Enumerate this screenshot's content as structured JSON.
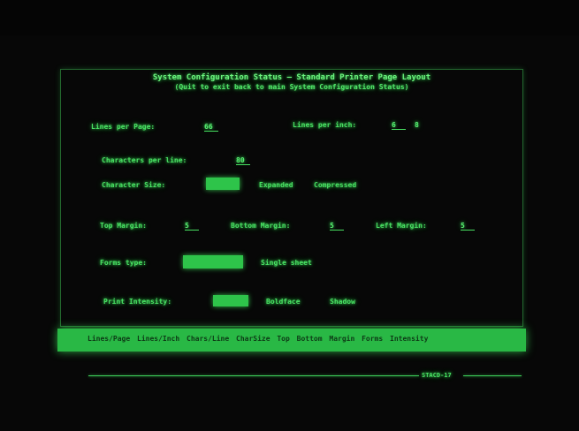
{
  "header": {
    "title": "System Configuration Status — Standard Printer Page Layout",
    "subtitle": "(Quit to exit back to main System Configuration Status)"
  },
  "fields": {
    "lines_per_page": {
      "label": "Lines per Page:",
      "value": "66"
    },
    "lines_per_inch": {
      "label": "Lines per inch:",
      "value": "6",
      "alt": "8"
    },
    "chars_per_line": {
      "label": "Characters per line:",
      "value": "80"
    },
    "character_size": {
      "label": "Character Size:",
      "option1": "Expanded",
      "option2": "Compressed"
    },
    "top_margin": {
      "label": "Top Margin:",
      "value": "5"
    },
    "bottom_margin": {
      "label": "Bottom Margin:",
      "value": "5"
    },
    "left_margin": {
      "label": "Left Margin:",
      "value": "5"
    },
    "forms_type": {
      "label": "Forms type:",
      "option1": "Single sheet"
    },
    "print_intensity": {
      "label": "Print Intensity:",
      "option1": "Boldface",
      "option2": "Shadow"
    }
  },
  "menu": {
    "items": [
      "Lines/Page",
      "Lines/Inch",
      "Chars/Line",
      "CharSize",
      "Top",
      "Bottom",
      "Margin",
      "Forms",
      "Intensity"
    ]
  },
  "status": {
    "text": "STACD-17"
  },
  "colors": {
    "phosphor": "#45e060",
    "background": "#070707",
    "highlight": "#2ec44a"
  }
}
